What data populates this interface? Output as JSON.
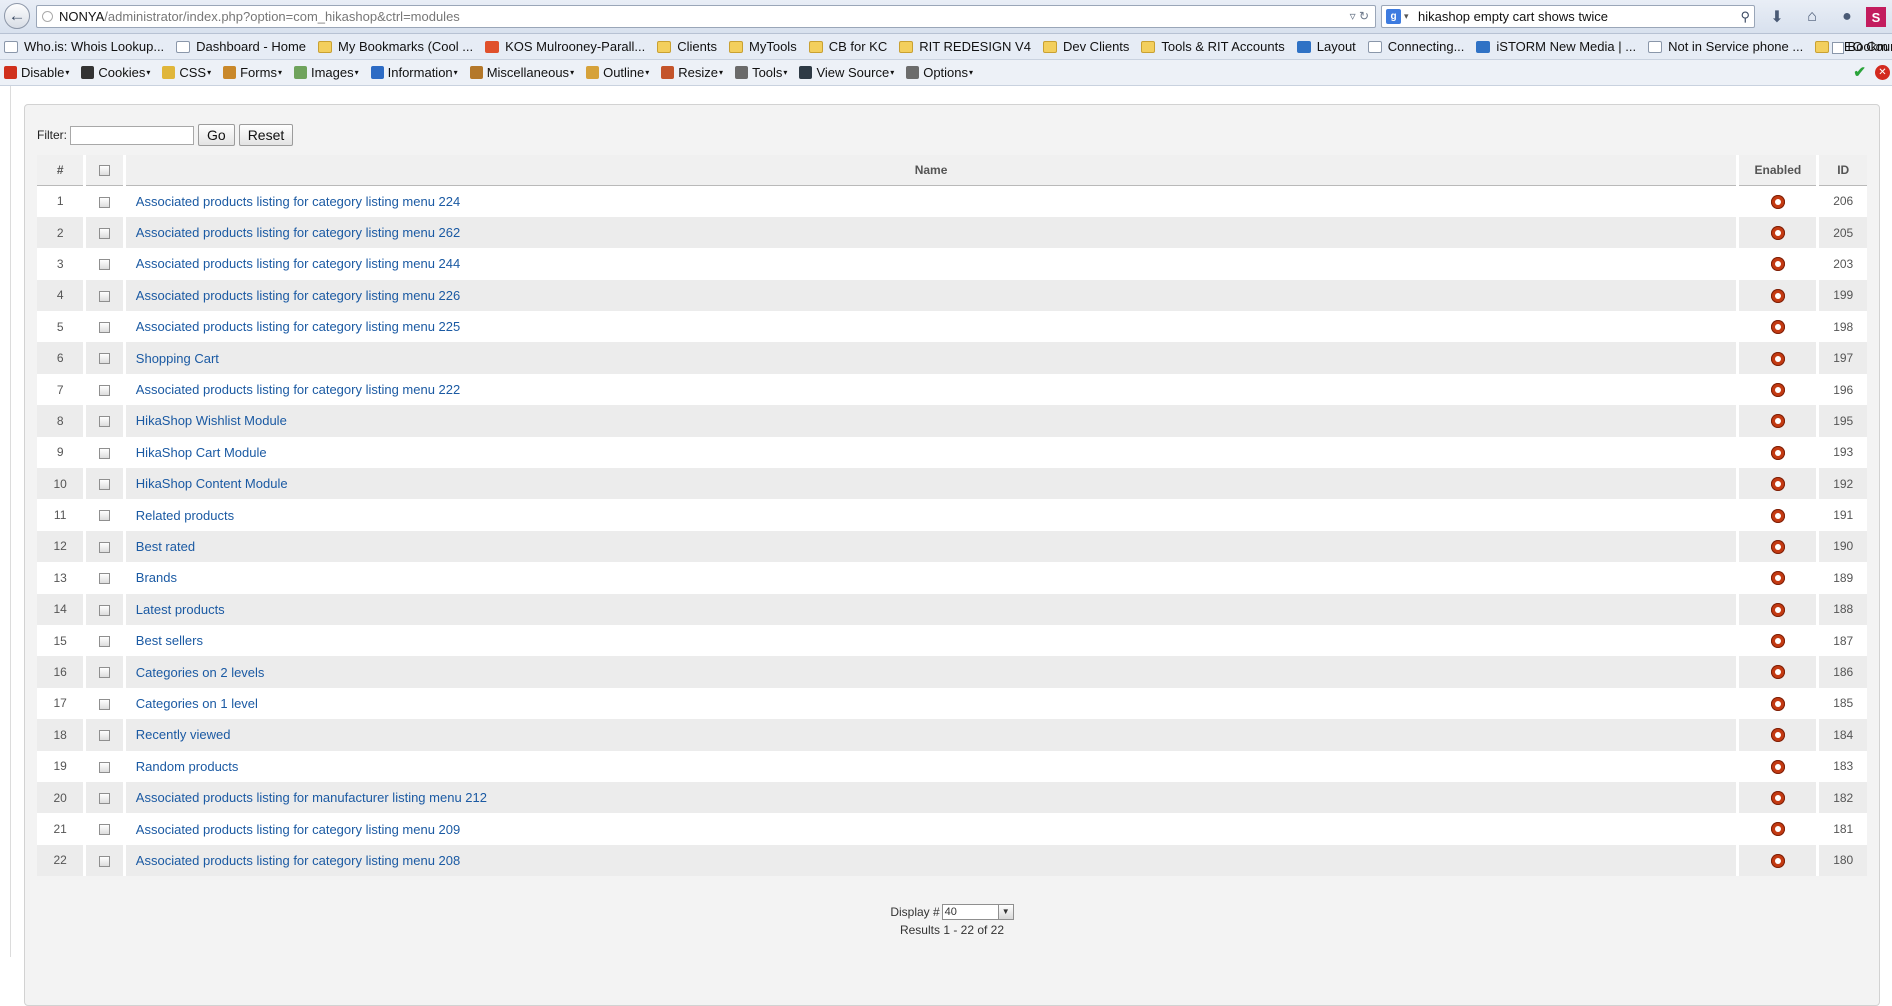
{
  "browser": {
    "url_host": "NONYA",
    "url_path": "/administrator/index.php?option=com_hikashop&ctrl=modules",
    "search_query": "hikashop empty cart shows twice",
    "bookmarks": [
      {
        "label": "Who.is: Whois Lookup...",
        "icon": "whois-icon"
      },
      {
        "label": "Dashboard - Home",
        "icon": "page-icon"
      },
      {
        "label": "My Bookmarks (Cool ...",
        "icon": "folder-icon"
      },
      {
        "label": "KOS Mulrooney-Parall...",
        "icon": "parallels-icon"
      },
      {
        "label": "Clients",
        "icon": "folder-icon"
      },
      {
        "label": "MyTools",
        "icon": "folder-icon"
      },
      {
        "label": "CB for KC",
        "icon": "folder-icon"
      },
      {
        "label": "RIT REDESIGN V4",
        "icon": "folder-icon"
      },
      {
        "label": "Dev Clients",
        "icon": "folder-icon"
      },
      {
        "label": "Tools & RIT Accounts",
        "icon": "folder-icon"
      },
      {
        "label": "Layout",
        "icon": "layout-icon"
      },
      {
        "label": "Connecting...",
        "icon": "page-icon"
      },
      {
        "label": "iSTORM New Media | ...",
        "icon": "istorm-icon"
      },
      {
        "label": "Not in Service phone ...",
        "icon": "phone-icon"
      },
      {
        "label": "SEO Course Resources",
        "icon": "folder-icon"
      }
    ],
    "bookmarks_more": "»",
    "bookmarks_menu": "Bookm",
    "toolbar": [
      {
        "label": "Disable",
        "icon": "disable-icon"
      },
      {
        "label": "Cookies",
        "icon": "cookies-icon"
      },
      {
        "label": "CSS",
        "icon": "css-icon"
      },
      {
        "label": "Forms",
        "icon": "forms-icon"
      },
      {
        "label": "Images",
        "icon": "images-icon"
      },
      {
        "label": "Information",
        "icon": "information-icon"
      },
      {
        "label": "Miscellaneous",
        "icon": "miscellaneous-icon"
      },
      {
        "label": "Outline",
        "icon": "outline-icon"
      },
      {
        "label": "Resize",
        "icon": "resize-icon"
      },
      {
        "label": "Tools",
        "icon": "tools-icon"
      },
      {
        "label": "View Source",
        "icon": "view-source-icon"
      },
      {
        "label": "Options",
        "icon": "options-icon"
      }
    ]
  },
  "filter": {
    "label": "Filter:",
    "value": "",
    "go_label": "Go",
    "reset_label": "Reset"
  },
  "table": {
    "headers": {
      "num": "#",
      "name": "Name",
      "enabled": "Enabled",
      "id": "ID"
    },
    "rows": [
      {
        "num": "1",
        "name": "Associated products listing for category listing menu 224",
        "id": "206"
      },
      {
        "num": "2",
        "name": "Associated products listing for category listing menu 262",
        "id": "205"
      },
      {
        "num": "3",
        "name": "Associated products listing for category listing menu 244",
        "id": "203"
      },
      {
        "num": "4",
        "name": "Associated products listing for category listing menu 226",
        "id": "199"
      },
      {
        "num": "5",
        "name": "Associated products listing for category listing menu 225",
        "id": "198"
      },
      {
        "num": "6",
        "name": "Shopping Cart",
        "id": "197"
      },
      {
        "num": "7",
        "name": "Associated products listing for category listing menu 222",
        "id": "196"
      },
      {
        "num": "8",
        "name": "HikaShop Wishlist Module",
        "id": "195"
      },
      {
        "num": "9",
        "name": "HikaShop Cart Module",
        "id": "193"
      },
      {
        "num": "10",
        "name": "HikaShop Content Module",
        "id": "192"
      },
      {
        "num": "11",
        "name": "Related products",
        "id": "191"
      },
      {
        "num": "12",
        "name": "Best rated",
        "id": "190"
      },
      {
        "num": "13",
        "name": "Brands",
        "id": "189"
      },
      {
        "num": "14",
        "name": "Latest products",
        "id": "188"
      },
      {
        "num": "15",
        "name": "Best sellers",
        "id": "187"
      },
      {
        "num": "16",
        "name": "Categories on 2 levels",
        "id": "186"
      },
      {
        "num": "17",
        "name": "Categories on 1 level",
        "id": "185"
      },
      {
        "num": "18",
        "name": "Recently viewed",
        "id": "184"
      },
      {
        "num": "19",
        "name": "Random products",
        "id": "183"
      },
      {
        "num": "20",
        "name": "Associated products listing for manufacturer listing menu 212",
        "id": "182"
      },
      {
        "num": "21",
        "name": "Associated products listing for category listing menu 209",
        "id": "181"
      },
      {
        "num": "22",
        "name": "Associated products listing for category listing menu 208",
        "id": "180"
      }
    ]
  },
  "pagination": {
    "display_label": "Display #",
    "display_value": "40",
    "results_text": "Results 1 - 22 of 22"
  },
  "colors": {
    "link": "#1b5aa3",
    "enabled_icon": "#c43a12",
    "row_alt": "#ececec"
  }
}
